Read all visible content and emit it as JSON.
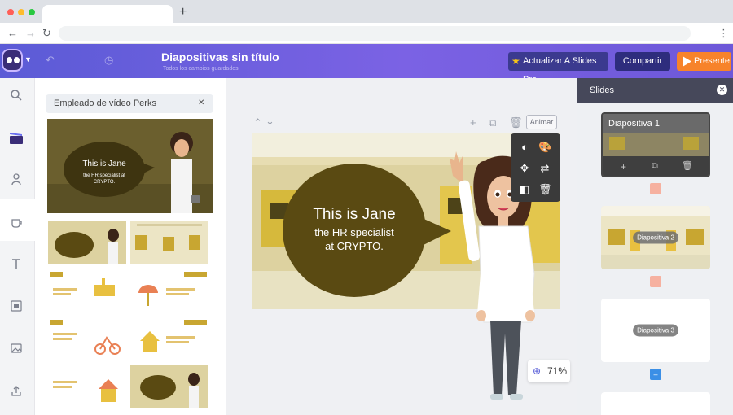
{
  "browser": {
    "new_tab": "+"
  },
  "app": {
    "title": "Diapositivas sin título",
    "subtitle": "Todos los cambios guardados",
    "upgrade_label": "Actualizar A Slides Pro",
    "share_label": "Compartir",
    "present_label": "Presente"
  },
  "templates": {
    "search_value": "Empleado de vídeo Perks",
    "preview_heading": "This is Jane",
    "preview_body": "the HR specialist at CRYPTO."
  },
  "canvas": {
    "animate_label": "Animar",
    "zoom": "71%",
    "slide_heading": "This is Jane",
    "slide_line1": "the HR specialist",
    "slide_line2": "at CRYPTO."
  },
  "slides": {
    "header": "Slides",
    "items": [
      {
        "label": "Diapositiva 1"
      },
      {
        "label": "Diapositiva 2"
      },
      {
        "label": "Diapositiva 3"
      }
    ]
  },
  "colors": {
    "header_start": "#5b5bd6",
    "present": "#f7832a",
    "bubble": "#5a4a12",
    "slide_bg": "#ddd2a0"
  }
}
